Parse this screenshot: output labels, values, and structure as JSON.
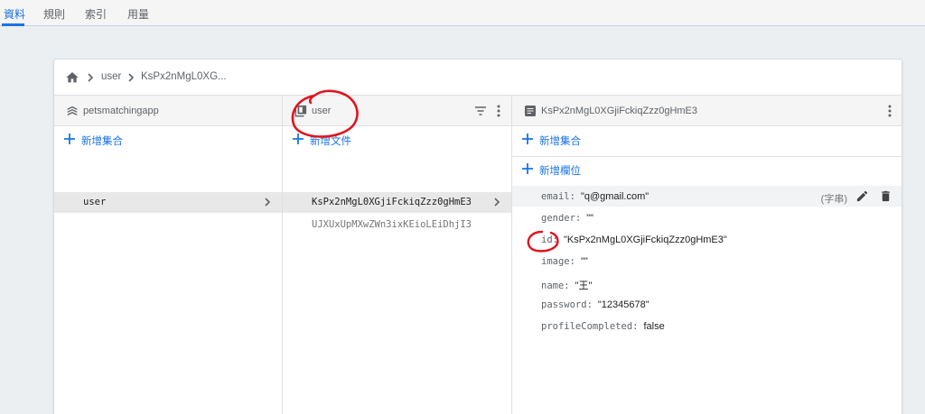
{
  "tabs": [
    "資料",
    "規則",
    "索引",
    "用量"
  ],
  "breadcrumb": {
    "collection": "user",
    "document": "KsPx2nMgL0XG..."
  },
  "project": {
    "name": "petsmatchingapp",
    "add_label": "新增集合",
    "collections": [
      "user"
    ]
  },
  "collection": {
    "name": "user",
    "add_label": "新增文件",
    "documents": [
      "KsPx2nMgL0XGjiFckiqZzz0gHmE3",
      "UJXUxUpMXwZWn3ixKEioLEiDhjI3"
    ]
  },
  "document": {
    "id": "KsPx2nMgL0XGjiFckiqZzz0gHmE3",
    "add_collection_label": "新增集合",
    "add_field_label": "新增欄位",
    "fields": [
      {
        "key": "email:",
        "value": "\"q@gmail.com\"",
        "type": "(字串)"
      },
      {
        "key": "gender:",
        "value": "\"\""
      },
      {
        "key": "id:",
        "value": "\"KsPx2nMgL0XGjiFckiqZzz0gHmE3\""
      },
      {
        "key": "image:",
        "value": "\"\""
      },
      {
        "key": "name:",
        "value": "\"王\""
      },
      {
        "key": "password:",
        "value": "\"12345678\""
      },
      {
        "key": "profileCompleted:",
        "value": "false"
      }
    ]
  },
  "colors": {
    "accent": "#1a73e8",
    "annotation": "#e0141e",
    "selected_row": "#e8e8e8"
  },
  "icons": [
    "home-icon",
    "chevron-right-icon",
    "project-icon",
    "collection-icon",
    "document-icon",
    "filter-icon",
    "more-vert-icon",
    "plus-icon",
    "edit-icon",
    "delete-icon"
  ]
}
